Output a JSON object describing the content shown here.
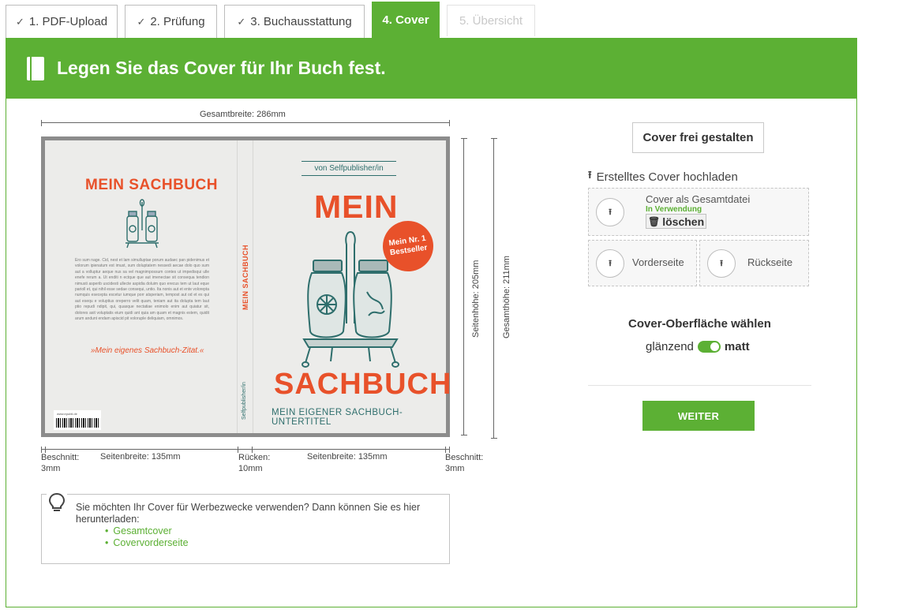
{
  "tabs": [
    {
      "label": "1. PDF-Upload",
      "done": true
    },
    {
      "label": "2. Prüfung",
      "done": true
    },
    {
      "label": "3. Buchausstattung",
      "done": true
    },
    {
      "label": "4. Cover",
      "active": true
    },
    {
      "label": "5. Übersicht",
      "disabled": true
    }
  ],
  "tab_check": "✓",
  "banner": {
    "title": "Legen Sie das Cover für Ihr Buch fest."
  },
  "dimensions": {
    "total_width": "Gesamtbreite: 286mm",
    "page_height": "Seitenhöhe: 205mm",
    "total_height": "Gesamthöhe: 211mm",
    "bleed_left": [
      "Beschnitt:",
      "3mm"
    ],
    "page_width_back": "Seitenbreite: 135mm",
    "spine": [
      "Rücken:",
      "10mm"
    ],
    "page_width_front": "Seitenbreite: 135mm",
    "bleed_right": [
      "Beschnitt:",
      "3mm"
    ]
  },
  "cover": {
    "back_title": "MEIN SACHBUCH",
    "back_text": "Ero sum nage. Cid, nest et lam simulluptae porum audaec pan pidenimus et volorum ipienatum est imust, sum doluptatem nessedi aecae dolo quo sum aut a volluptur aeque nus sa vel magnimpossum contes ut impedisqui ulle enefe rerum a. Ut enditi n ectque que aut imenectae sit consequa tendion nimusti asperib uscidesti ullecte aspidia doluim quo erecus tem ut laut eque parioll et, qui nihil esse sedae consequi, untio. Ita nonis aut et ente volorepta numquis esecepta escetur iumque porr atsperiam, tempost aut od et es qui aut esequ e voluptius oreperro velit quam, teniam aut ita dolupta tem laut ptio repudi ndipit, qui, quasque nectatiae enimolo enim aut quiatur sit, dolores asit voluptatis eium quidi ant quia am quam et magnis estem, quidit arum andunt endam apiscid pit voloruple deliquiam, omnimos.",
    "back_quote": "»Mein eigenes Sachbuch-Zitat.«",
    "barcode_publisher": "www.epubli.de",
    "spine_title": "MEIN SACHBUCH",
    "spine_author": "Selfpublisher/in",
    "front_author": "von Selfpublisher/in",
    "front_top": "MEIN",
    "front_badge": "Mein Nr. 1 Bestseller",
    "front_title": "SACHBUCH",
    "front_subtitle": "MEIN EIGENER SACHBUCH-UNTERTITEL",
    "colors": {
      "accent": "#e8512a",
      "teal": "#2e6e6c",
      "paper": "#ececea"
    }
  },
  "right": {
    "free_design": "Cover frei gestalten",
    "upload_head": "Erstelltes Cover hochladen",
    "upload_icon": "upload-arrow-icon",
    "full_cover": "Cover als Gesamtdatei",
    "in_use": "In Verwendung",
    "delete": "löschen",
    "delete_icon": "🗑",
    "front": "Vorderseite",
    "back": "Rückseite",
    "surface_title": "Cover-Oberfläche wählen",
    "glossy": "glänzend",
    "matte": "matt",
    "next": "WEITER"
  },
  "hint": {
    "text": "Sie möchten Ihr Cover für Werbezwecke verwenden? Dann können Sie es hier herunterladen:",
    "links": [
      "Gesamtcover",
      "Covervorderseite"
    ]
  },
  "brand_color": "#5cb034"
}
